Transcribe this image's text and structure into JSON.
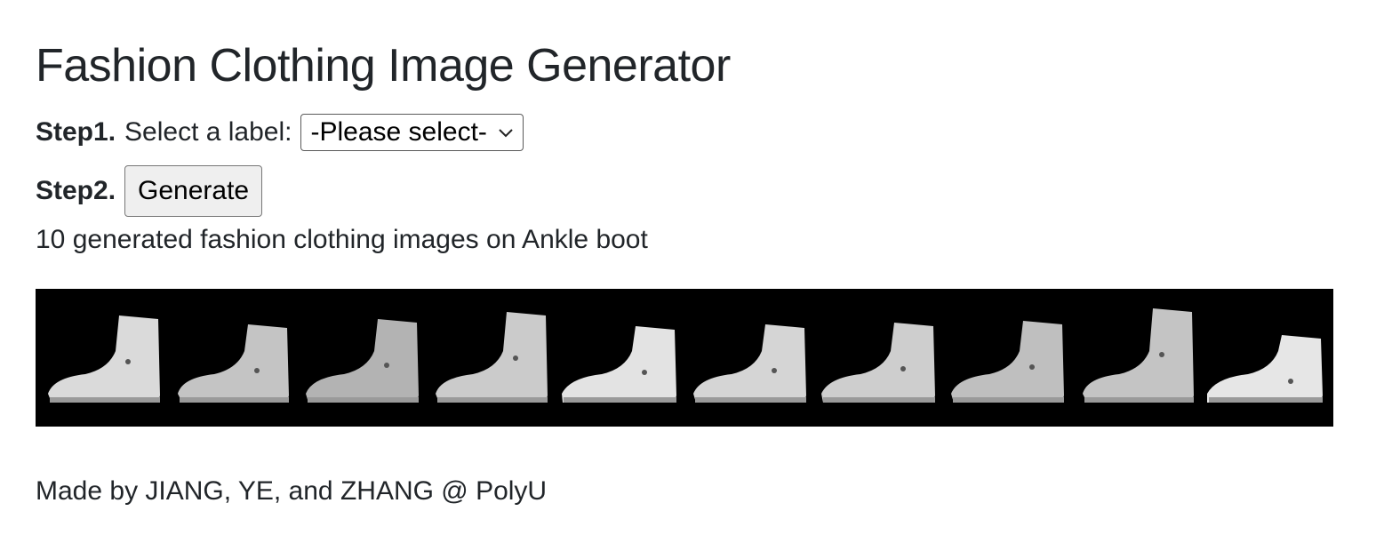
{
  "header": {
    "title": "Fashion Clothing Image Generator"
  },
  "step1": {
    "label": "Step1.",
    "text": "Select a label:",
    "select_value": "-Please select-"
  },
  "step2": {
    "label": "Step2.",
    "button_label": "Generate"
  },
  "result": {
    "caption": "10 generated fashion clothing images on Ankle boot",
    "image_count": 10,
    "item_icon": "ankle-boot-image"
  },
  "footer": {
    "text": "Made by JIANG, YE, and ZHANG @ PolyU"
  },
  "colors": {
    "text": "#212529",
    "strip_background": "#000000",
    "button_background": "#efefef"
  }
}
